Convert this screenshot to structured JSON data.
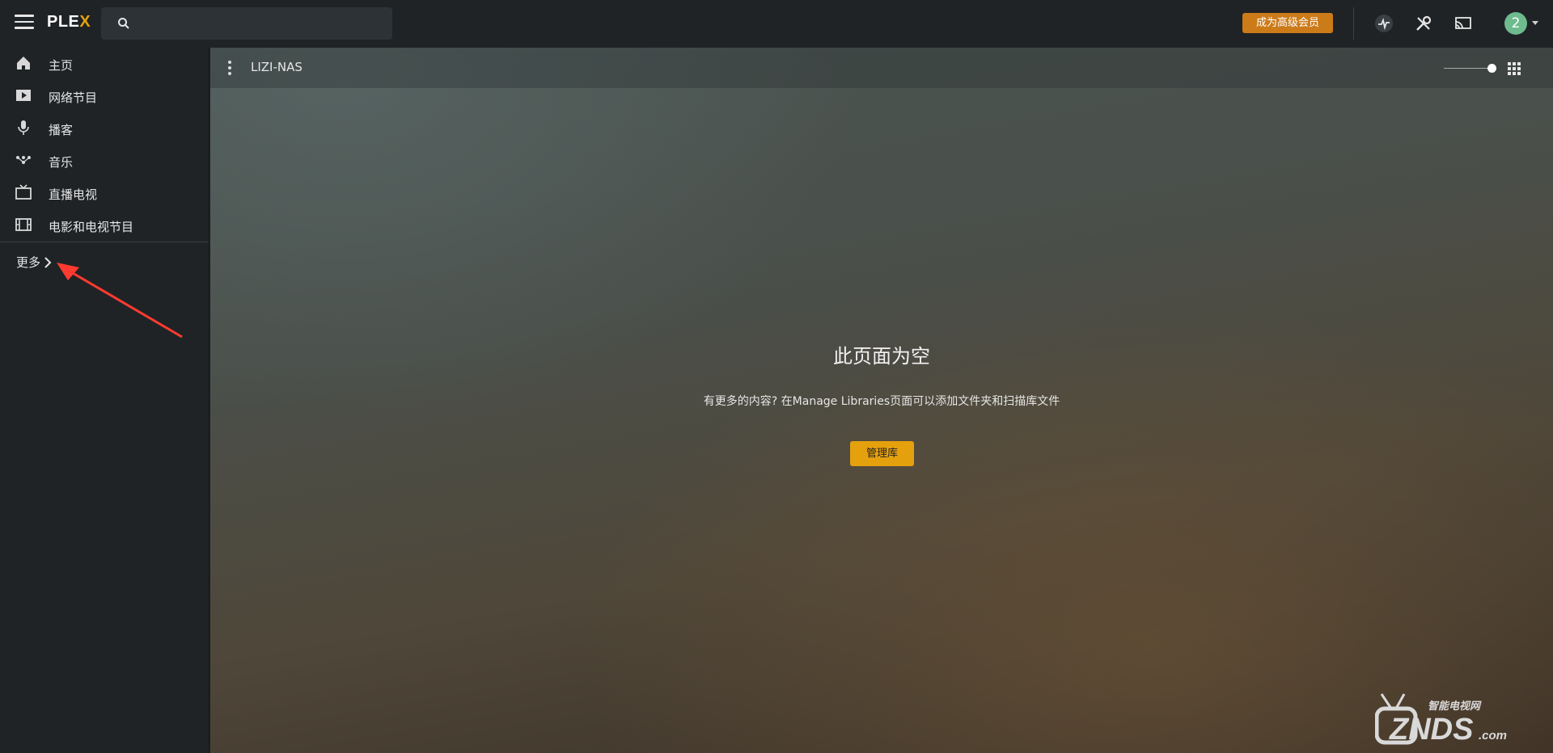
{
  "app": {
    "logo_main": "PLE",
    "logo_accent": "X"
  },
  "header": {
    "premium_label": "成为高级会员",
    "avatar_text": "2"
  },
  "sidebar": {
    "items": [
      {
        "label": "主页",
        "icon": "home-icon"
      },
      {
        "label": "网络节目",
        "icon": "play-box-icon"
      },
      {
        "label": "播客",
        "icon": "microphone-icon"
      },
      {
        "label": "音乐",
        "icon": "music-icon"
      },
      {
        "label": "直播电视",
        "icon": "tv-icon"
      },
      {
        "label": "电影和电视节目",
        "icon": "film-icon"
      }
    ],
    "more_label": "更多"
  },
  "main": {
    "server_name": "LIZI-NAS",
    "empty_title": "此页面为空",
    "empty_text": "有更多的内容? 在Manage Libraries页面可以添加文件夹和扫描库文件",
    "manage_button": "管理库"
  },
  "watermark": {
    "top": "智能电视网",
    "main": "ZNDS",
    "suffix": ".com"
  },
  "colors": {
    "accent": "#e5a00d",
    "premium": "#cc7b19",
    "annotation_arrow": "#ff3b30",
    "avatar": "#6ebb8e"
  }
}
